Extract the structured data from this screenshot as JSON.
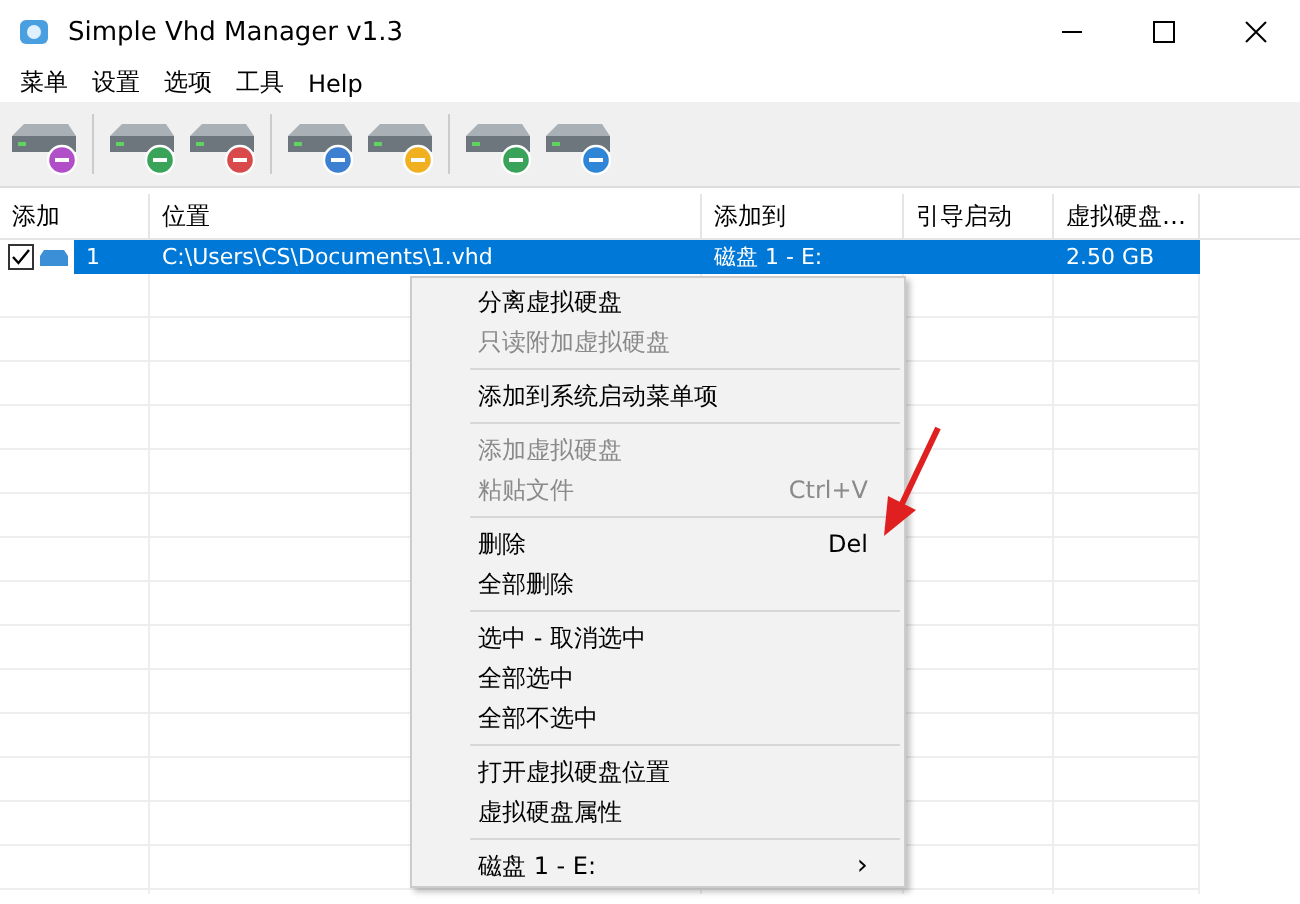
{
  "window": {
    "title": "Simple Vhd Manager v1.3"
  },
  "menubar": [
    "菜单",
    "设置",
    "选项",
    "工具",
    "Help"
  ],
  "table": {
    "columns": [
      "添加",
      "位置",
      "添加到",
      "引导启动",
      "虚拟硬盘…"
    ],
    "rows": [
      {
        "checked": true,
        "selected": true,
        "index": "1",
        "location": "C:\\Users\\CS\\Documents\\1.vhd",
        "attached_to": "磁盘 1 - E:",
        "size": "2.50 GB"
      }
    ]
  },
  "context_menu": [
    {
      "kind": "item",
      "label": "分离虚拟硬盘",
      "disabled": false
    },
    {
      "kind": "item",
      "label": "只读附加虚拟硬盘",
      "disabled": true
    },
    {
      "kind": "separator"
    },
    {
      "kind": "item",
      "label": "添加到系统启动菜单项",
      "disabled": false
    },
    {
      "kind": "separator"
    },
    {
      "kind": "item",
      "label": "添加虚拟硬盘",
      "disabled": true
    },
    {
      "kind": "item",
      "label": "粘贴文件",
      "shortcut": "Ctrl+V",
      "disabled": true
    },
    {
      "kind": "separator"
    },
    {
      "kind": "item",
      "label": "删除",
      "shortcut": "Del",
      "disabled": false
    },
    {
      "kind": "item",
      "label": "全部删除",
      "disabled": false
    },
    {
      "kind": "separator"
    },
    {
      "kind": "item",
      "label": "选中 - 取消选中",
      "disabled": false
    },
    {
      "kind": "item",
      "label": "全部选中",
      "disabled": false
    },
    {
      "kind": "item",
      "label": "全部不选中",
      "disabled": false
    },
    {
      "kind": "separator"
    },
    {
      "kind": "item",
      "label": "打开虚拟硬盘位置",
      "disabled": false
    },
    {
      "kind": "item",
      "label": "虚拟硬盘属性",
      "disabled": false
    },
    {
      "kind": "separator"
    },
    {
      "kind": "submenu",
      "label": "磁盘 1 - E:",
      "arrow": "›",
      "disabled": false
    }
  ]
}
